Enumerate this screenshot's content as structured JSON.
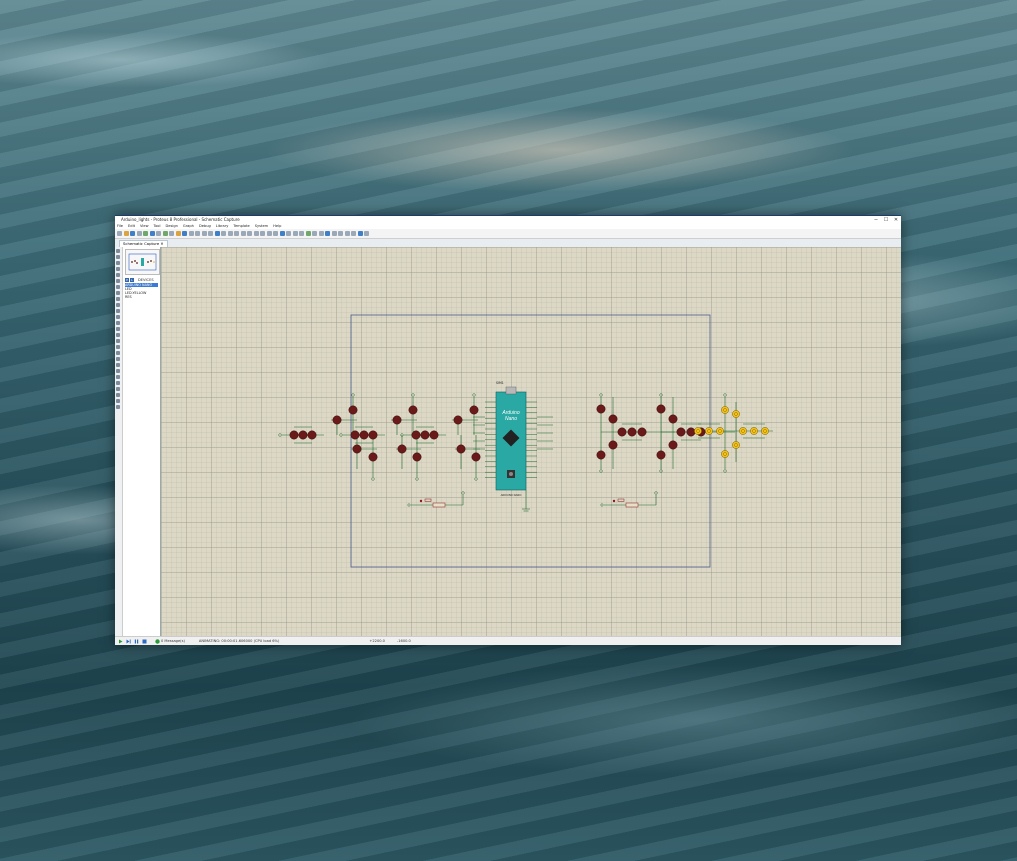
{
  "window": {
    "title": "Arduino_lights - Proteus 8 Professional - Schematic Capture",
    "controls": {
      "minimize": "─",
      "maximize": "☐",
      "close": "✕"
    }
  },
  "menu": [
    "File",
    "Edit",
    "View",
    "Tool",
    "Design",
    "Graph",
    "Debug",
    "Library",
    "Template",
    "System",
    "Help"
  ],
  "tabs": [
    {
      "label": "Schematic Capture",
      "close": "✕"
    }
  ],
  "devices_panel": {
    "buttons": [
      "P",
      "L"
    ],
    "title": "DEVICES",
    "items": [
      "ARDUINO NANO",
      "LED",
      "LED-YELLOW",
      "RES"
    ],
    "selected_index": 0
  },
  "schematic": {
    "mcu_ref": "SIM1",
    "mcu_line1": "Arduino",
    "mcu_line2": "Nano",
    "mcu_part": "ARDUINO NANO",
    "led_red_color": "#6b1a1a",
    "led_yellow_color": "#f2c21b"
  },
  "status": {
    "messages": "0 Message(s)",
    "animation": "ANIMATING: 00:00:01.606000 (CPU load 6%)",
    "coord_x": "+2200.0",
    "coord_y": "-1600.0"
  },
  "colors": {
    "accent": "#1d3b6b",
    "board": "#2aa8a3"
  }
}
